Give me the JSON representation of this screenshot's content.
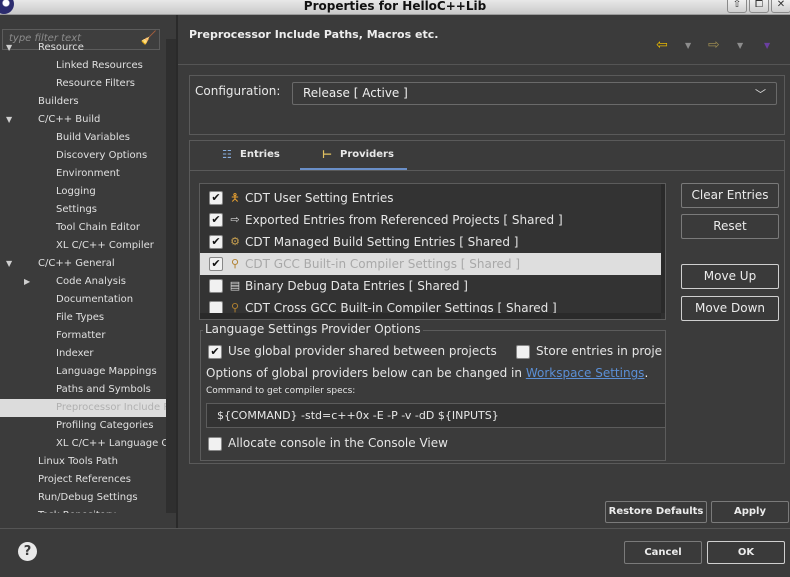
{
  "window": {
    "title": "Properties for HelloC++Lib",
    "controls": [
      "⇧",
      "⧠",
      "✕"
    ]
  },
  "sidebar": {
    "filter_placeholder": "type filter text",
    "items": [
      {
        "label": "Resource",
        "level": 1,
        "expanded": true
      },
      {
        "label": "Linked Resources",
        "level": 2
      },
      {
        "label": "Resource Filters",
        "level": 2
      },
      {
        "label": "Builders",
        "level": 1
      },
      {
        "label": "C/C++ Build",
        "level": 1,
        "expanded": true
      },
      {
        "label": "Build Variables",
        "level": 2
      },
      {
        "label": "Discovery Options",
        "level": 2
      },
      {
        "label": "Environment",
        "level": 2
      },
      {
        "label": "Logging",
        "level": 2
      },
      {
        "label": "Settings",
        "level": 2
      },
      {
        "label": "Tool Chain Editor",
        "level": 2
      },
      {
        "label": "XL C/C++ Compiler",
        "level": 2
      },
      {
        "label": "C/C++ General",
        "level": 1,
        "expanded": true
      },
      {
        "label": "Code Analysis",
        "level": 2,
        "collapsed": true
      },
      {
        "label": "Documentation",
        "level": 2
      },
      {
        "label": "File Types",
        "level": 2
      },
      {
        "label": "Formatter",
        "level": 2
      },
      {
        "label": "Indexer",
        "level": 2
      },
      {
        "label": "Language Mappings",
        "level": 2
      },
      {
        "label": "Paths and Symbols",
        "level": 2
      },
      {
        "label": "Preprocessor Include Paths, Macros etc.",
        "level": 2,
        "selected": true
      },
      {
        "label": "Profiling Categories",
        "level": 2
      },
      {
        "label": "XL C/C++ Language Options",
        "level": 2
      },
      {
        "label": "Linux Tools Path",
        "level": 1
      },
      {
        "label": "Project References",
        "level": 1
      },
      {
        "label": "Run/Debug Settings",
        "level": 1
      },
      {
        "label": "Task Repository",
        "level": 1
      }
    ]
  },
  "page": {
    "title": "Preprocessor Include Paths, Macros etc.",
    "nav": {
      "back_icon": "back-arrow-icon",
      "forward_icon": "forward-arrow-icon",
      "menu_icon": "view-menu-icon"
    }
  },
  "configuration": {
    "label": "Configuration:",
    "value": "Release  [ Active ]"
  },
  "tabs": [
    {
      "label": "Entries",
      "icon": "entries-icon"
    },
    {
      "label": "Providers",
      "icon": "providers-icon",
      "active": true
    }
  ],
  "providers": [
    {
      "label": "CDT User Setting Entries",
      "checked": true,
      "icon": "user-icon"
    },
    {
      "label": "Exported Entries from Referenced Projects   [ Shared ]",
      "checked": true,
      "icon": "export-icon"
    },
    {
      "label": "CDT Managed Build Setting Entries   [ Shared ]",
      "checked": true,
      "icon": "build-icon"
    },
    {
      "label": "CDT GCC Built-in Compiler Settings   [ Shared ]",
      "checked": true,
      "icon": "compiler-icon",
      "selected": true
    },
    {
      "label": "Binary Debug Data Entries   [ Shared ]",
      "checked": false,
      "icon": "debug-data-icon"
    },
    {
      "label": "CDT Cross GCC Built-in Compiler Settings   [ Shared ]",
      "checked": false,
      "icon": "compiler-icon"
    }
  ],
  "side_buttons": {
    "clear": "Clear Entries",
    "reset": "Reset",
    "move_up": "Move Up",
    "move_down": "Move Down"
  },
  "options": {
    "group_title": "Language Settings Provider Options",
    "use_global": {
      "label": "Use global provider shared between projects",
      "checked": true
    },
    "store_entries": {
      "label": "Store entries in proje",
      "checked": false
    },
    "info_prefix": "Options of global providers below can be changed in ",
    "info_link": "Workspace Settings",
    "info_suffix": ".",
    "command_label": "Command to get compiler specs:",
    "command_value": "${COMMAND} -std=c++0x -E -P -v -dD ${INPUTS}",
    "allocate_console": {
      "label": "Allocate console in the Console View",
      "checked": false
    }
  },
  "footer": {
    "restore_defaults": "Restore Defaults",
    "apply": "Apply",
    "cancel": "Cancel",
    "ok": "OK",
    "help": "?"
  }
}
